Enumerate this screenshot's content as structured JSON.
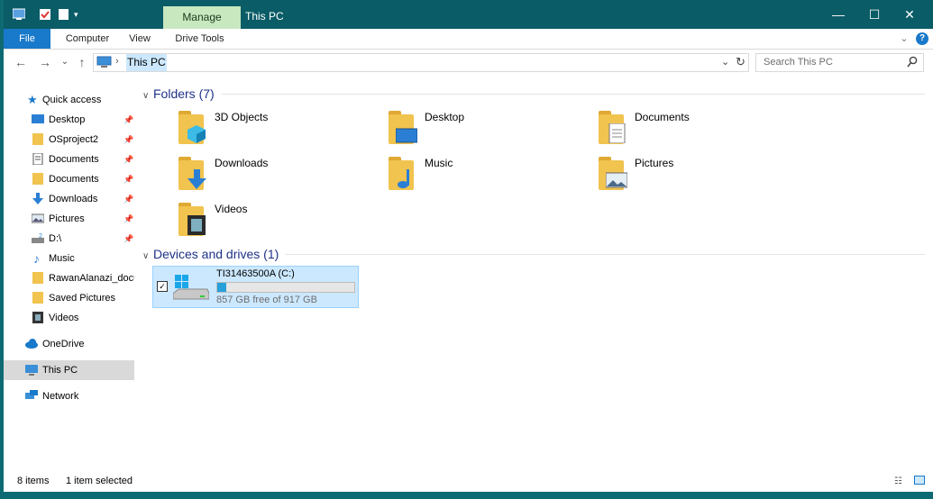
{
  "window": {
    "title": "This PC",
    "manage_tab": "Manage",
    "minimize": "—",
    "maximize": "☐",
    "close": "✕"
  },
  "ribbon": {
    "tabs": [
      "File",
      "Computer",
      "View",
      "Drive Tools"
    ],
    "collapse": "⌄",
    "help": "?"
  },
  "nav": {
    "back": "←",
    "forward": "→",
    "recent": "⌄",
    "up": "↑"
  },
  "address": {
    "separator": "›",
    "path": "This PC",
    "dropdown": "⌄",
    "refresh": "↻"
  },
  "search": {
    "placeholder": "Search This PC",
    "icon": "search-icon"
  },
  "sidebar": {
    "quick_access": "Quick access",
    "items": [
      {
        "label": "Desktop",
        "icon": "desktop-icon",
        "pinned": true
      },
      {
        "label": "OSproject2",
        "icon": "folder-icon",
        "pinned": true
      },
      {
        "label": "Documents",
        "icon": "documents-icon",
        "pinned": true
      },
      {
        "label": "Documents",
        "icon": "folder-icon",
        "pinned": true
      },
      {
        "label": "Downloads",
        "icon": "download-icon",
        "pinned": true
      },
      {
        "label": "Pictures",
        "icon": "pictures-icon",
        "pinned": true
      },
      {
        "label": "D:\\",
        "icon": "drive-icon",
        "pinned": true
      },
      {
        "label": "Music",
        "icon": "music-icon",
        "pinned": false
      },
      {
        "label": "RawanAlanazi_docu",
        "icon": "folder-icon",
        "pinned": false
      },
      {
        "label": "Saved Pictures",
        "icon": "folder-icon",
        "pinned": false
      },
      {
        "label": "Videos",
        "icon": "videos-icon",
        "pinned": false
      }
    ],
    "onedrive": "OneDrive",
    "this_pc": "This PC",
    "network": "Network",
    "pin_glyph": "📌"
  },
  "main": {
    "folders_header": "Folders (7)",
    "folders": [
      {
        "name": "3D Objects",
        "icon": "3d-objects-icon"
      },
      {
        "name": "Desktop",
        "icon": "desktop-folder-icon"
      },
      {
        "name": "Documents",
        "icon": "documents-folder-icon"
      },
      {
        "name": "Downloads",
        "icon": "downloads-folder-icon"
      },
      {
        "name": "Music",
        "icon": "music-folder-icon"
      },
      {
        "name": "Pictures",
        "icon": "pictures-folder-icon"
      },
      {
        "name": "Videos",
        "icon": "videos-folder-icon"
      }
    ],
    "drives_header": "Devices and drives (1)",
    "drive": {
      "name": "TI31463500A (C:)",
      "free_text": "857 GB free of 917 GB",
      "used_fraction": 0.065,
      "checked": "✓"
    }
  },
  "status": {
    "items": "8 items",
    "selected": "1 item selected"
  },
  "colors": {
    "accent": "#1979ca",
    "titlebar": "#0a5c66",
    "selection": "#cce8ff",
    "progress": "#26a0da"
  }
}
